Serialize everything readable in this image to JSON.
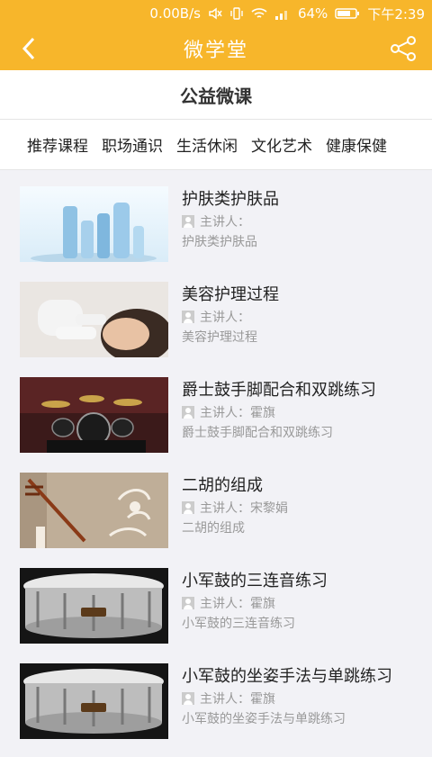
{
  "status": {
    "speed": "0.00B/s",
    "battery": "64%",
    "time": "下午2:39"
  },
  "header": {
    "title": "微学堂"
  },
  "section": {
    "title": "公益微课"
  },
  "categories": [
    "推荐课程",
    "职场通识",
    "生活休闲",
    "文化艺术",
    "健康保健"
  ],
  "courses": [
    {
      "title": "护肤类护肤品",
      "speaker_label": "主讲人：",
      "speaker": "",
      "desc": "护肤类护肤品"
    },
    {
      "title": "美容护理过程",
      "speaker_label": "主讲人：",
      "speaker": "",
      "desc": "美容护理过程"
    },
    {
      "title": "爵士鼓手脚配合和双跳练习",
      "speaker_label": "主讲人：",
      "speaker": "霍旗",
      "desc": "爵士鼓手脚配合和双跳练习"
    },
    {
      "title": "二胡的组成",
      "speaker_label": "主讲人：",
      "speaker": "宋黎娟",
      "desc": "二胡的组成"
    },
    {
      "title": "小军鼓的三连音练习",
      "speaker_label": "主讲人：",
      "speaker": "霍旗",
      "desc": "小军鼓的三连音练习"
    },
    {
      "title": "小军鼓的坐姿手法与单跳练习",
      "speaker_label": "主讲人：",
      "speaker": "霍旗",
      "desc": "小军鼓的坐姿手法与单跳练习"
    }
  ],
  "icons": {
    "back": "chevron-left-icon",
    "share": "share-icon",
    "user": "user-icon"
  },
  "colors": {
    "accent": "#f7b62b"
  }
}
